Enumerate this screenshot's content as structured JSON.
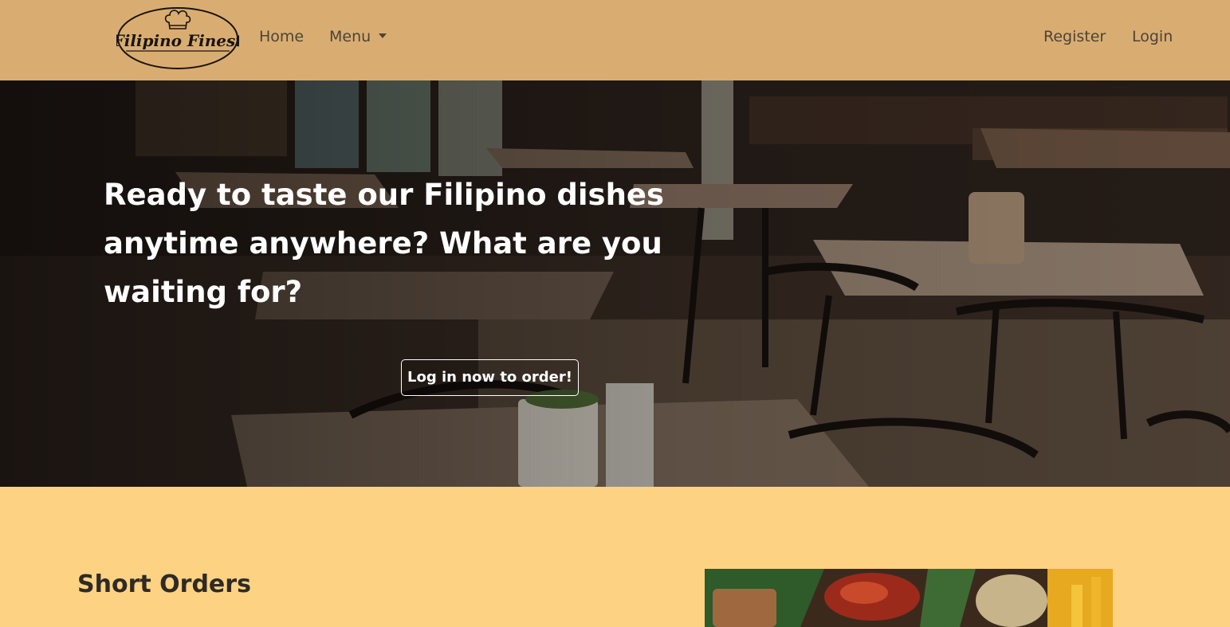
{
  "brand": {
    "logo_text": "Filipino Finest",
    "logo_icon": "chef-hat-icon"
  },
  "nav": {
    "home": "Home",
    "menu": "Menu",
    "register": "Register",
    "login": "Login"
  },
  "hero": {
    "line1": "Ready to taste our Filipino dishes",
    "line2": "anytime anywhere? What are you",
    "line3": "waiting for?",
    "cta": "Log in now to order!"
  },
  "section": {
    "title": "Short Orders"
  },
  "colors": {
    "navbar": "#d9ad71",
    "page_background": "#fdd283",
    "nav_text": "#4c4339"
  }
}
